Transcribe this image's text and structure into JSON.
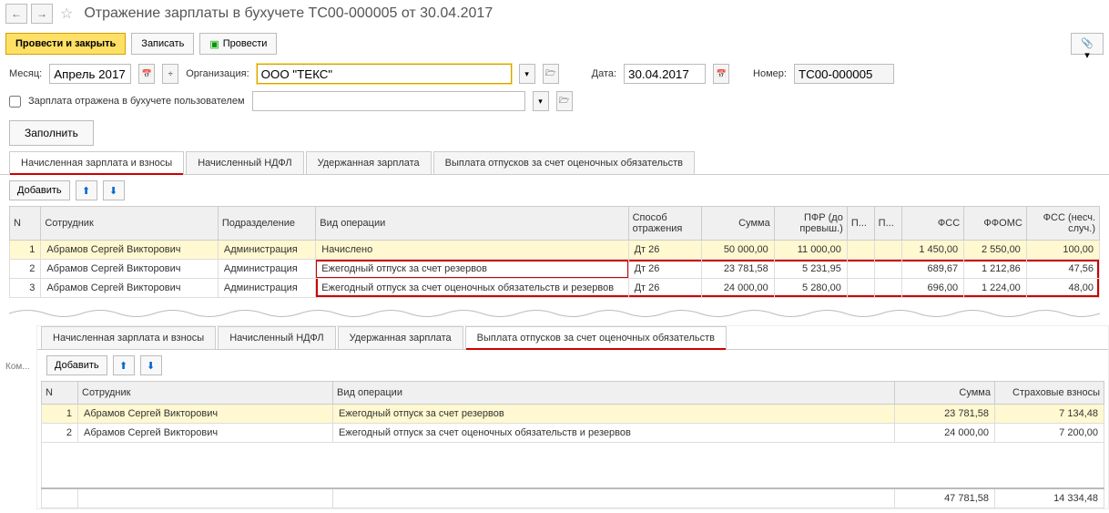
{
  "header": {
    "title": "Отражение зарплаты в бухучете ТС00-000005 от 30.04.2017"
  },
  "actions": {
    "post_close": "Провести и закрыть",
    "save": "Записать",
    "post": "Провести"
  },
  "form": {
    "month_label": "Месяц:",
    "month_value": "Апрель 2017",
    "org_label": "Организация:",
    "org_value": "ООО \"ТЕКС\"",
    "date_label": "Дата:",
    "date_value": "30.04.2017",
    "number_label": "Номер:",
    "number_value": "ТС00-000005",
    "user_reflected_label": "Зарплата отражена в бухучете пользователем"
  },
  "fill_btn": "Заполнить",
  "tabs1": {
    "t1": "Начисленная зарплата и взносы",
    "t2": "Начисленный НДФЛ",
    "t3": "Удержанная зарплата",
    "t4": "Выплата отпусков за счет оценочных обязательств"
  },
  "tbl_toolbar": {
    "add": "Добавить"
  },
  "tbl1": {
    "cols": {
      "n": "N",
      "employee": "Сотрудник",
      "dept": "Подразделение",
      "op_type": "Вид операции",
      "refl_method": "Способ отражения",
      "sum": "Сумма",
      "pfr": "ПФР (до превыш.)",
      "p1": "П...",
      "p2": "П...",
      "fss": "ФСС",
      "ffoms": "ФФОМС",
      "fss_nesch": "ФСС (несч. случ.)"
    },
    "rows": [
      {
        "n": "1",
        "emp": "Абрамов Сергей Викторович",
        "dept": "Администрация",
        "op": "Начислено",
        "refl": "Дт 26",
        "sum": "50 000,00",
        "pfr": "11 000,00",
        "p1": "",
        "p2": "",
        "fss": "1 450,00",
        "ffoms": "2 550,00",
        "fssn": "100,00"
      },
      {
        "n": "2",
        "emp": "Абрамов Сергей Викторович",
        "dept": "Администрация",
        "op": "Ежегодный отпуск за счет резервов",
        "refl": "Дт 26",
        "sum": "23 781,58",
        "pfr": "5 231,95",
        "p1": "",
        "p2": "",
        "fss": "689,67",
        "ffoms": "1 212,86",
        "fssn": "47,56"
      },
      {
        "n": "3",
        "emp": "Абрамов Сергей Викторович",
        "dept": "Администрация",
        "op": "Ежегодный отпуск за счет оценочных обязательств и резервов",
        "refl": "Дт 26",
        "sum": "24 000,00",
        "pfr": "5 280,00",
        "p1": "",
        "p2": "",
        "fss": "696,00",
        "ffoms": "1 224,00",
        "fssn": "48,00"
      }
    ]
  },
  "side_label": "Ком...",
  "tabs2": {
    "t1": "Начисленная зарплата и взносы",
    "t2": "Начисленный НДФЛ",
    "t3": "Удержанная зарплата",
    "t4": "Выплата отпусков за счет оценочных обязательств"
  },
  "tbl2": {
    "cols": {
      "n": "N",
      "employee": "Сотрудник",
      "op_type": "Вид операции",
      "sum": "Сумма",
      "ins": "Страховые взносы"
    },
    "rows": [
      {
        "n": "1",
        "emp": "Абрамов Сергей Викторович",
        "op": "Ежегодный отпуск за счет резервов",
        "sum": "23 781,58",
        "ins": "7 134,48"
      },
      {
        "n": "2",
        "emp": "Абрамов Сергей Викторович",
        "op": "Ежегодный отпуск за счет оценочных обязательств и резервов",
        "sum": "24 000,00",
        "ins": "7 200,00"
      }
    ],
    "totals": {
      "sum": "47 781,58",
      "ins": "14 334,48"
    }
  }
}
